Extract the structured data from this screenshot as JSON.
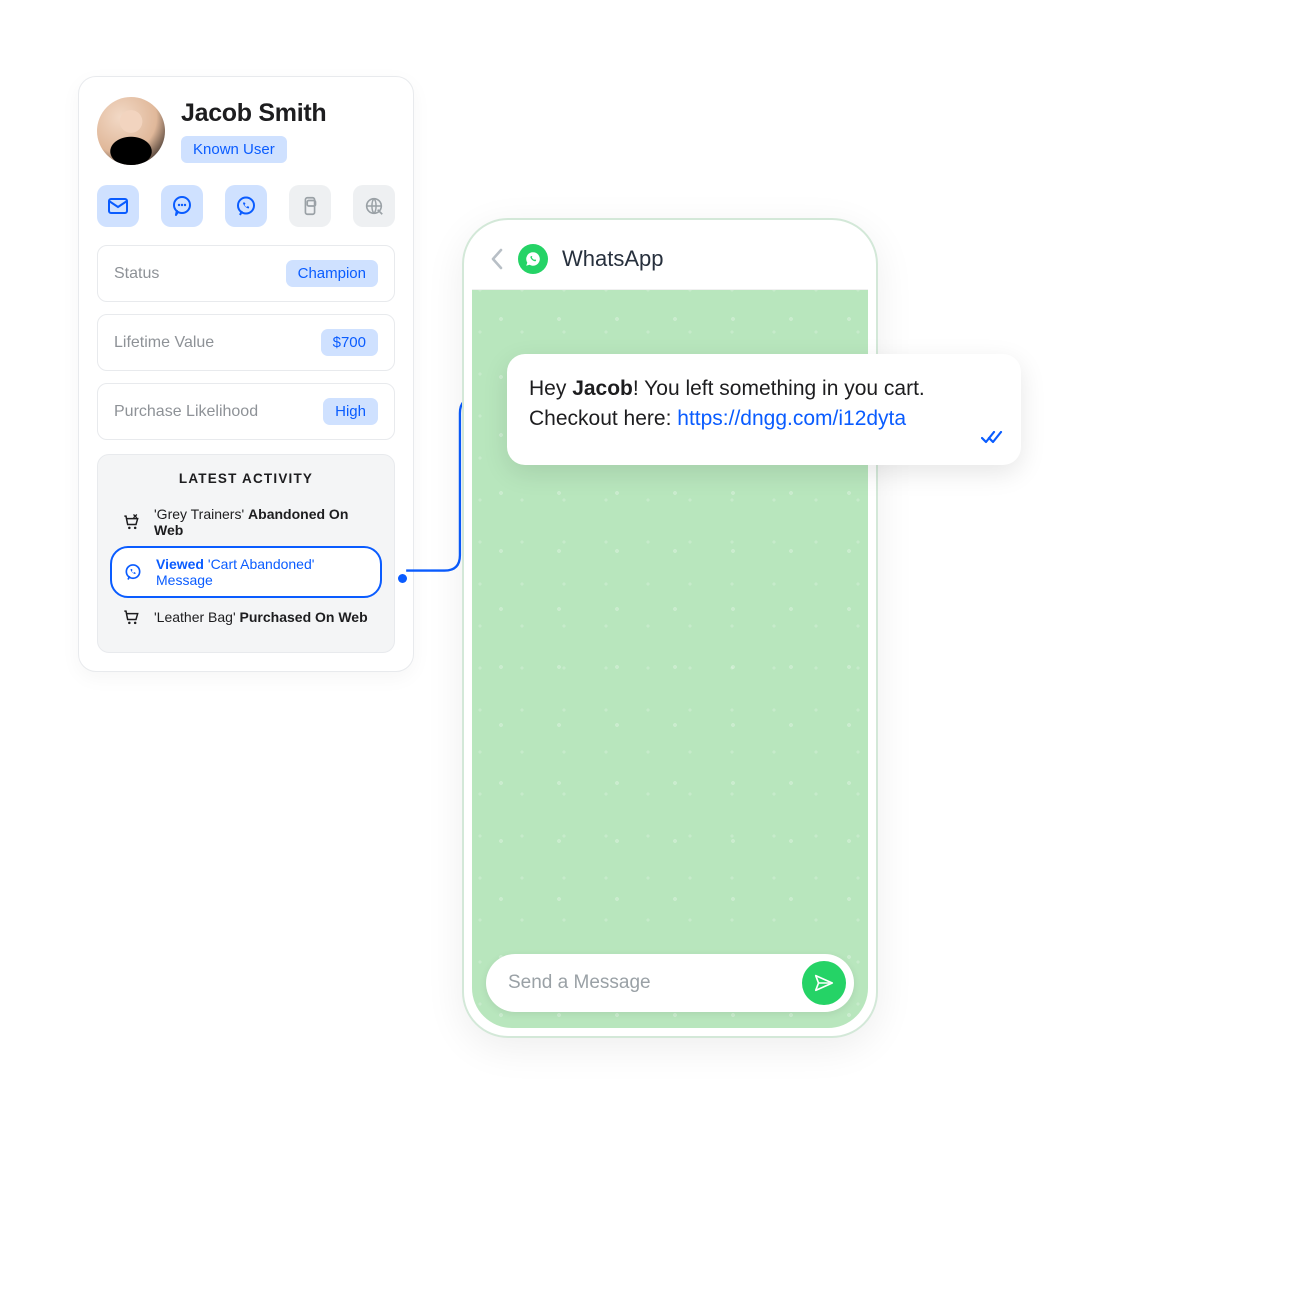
{
  "profile": {
    "name": "Jacob Smith",
    "badge": "Known User",
    "channels": [
      {
        "id": "email",
        "active": true
      },
      {
        "id": "sms",
        "active": true
      },
      {
        "id": "whatsapp",
        "active": true
      },
      {
        "id": "push",
        "active": false
      },
      {
        "id": "web",
        "active": false
      }
    ],
    "stats": [
      {
        "label": "Status",
        "value": "Champion"
      },
      {
        "label": "Lifetime Value",
        "value": "$700"
      },
      {
        "label": "Purchase Likelihood",
        "value": "High"
      }
    ],
    "activity_title": "LATEST ACTIVITY",
    "activities": [
      {
        "icon": "cart-x",
        "pre": "'Grey Trainers' ",
        "bold": "Abandoned On Web",
        "post": ""
      },
      {
        "icon": "whatsapp",
        "pre": "",
        "bold": "Viewed",
        "post": " 'Cart Abandoned' Message",
        "highlight": true
      },
      {
        "icon": "cart",
        "pre": "'Leather Bag' ",
        "bold": "Purchased On Web",
        "post": ""
      }
    ]
  },
  "phone": {
    "app_name": "WhatsApp",
    "compose_placeholder": "Send a Message"
  },
  "message": {
    "pre": "Hey ",
    "bold": "Jacob",
    "mid": "! You left something in you cart. Checkout here: ",
    "link": "https://dngg.com/i12dyta"
  },
  "colors": {
    "accent": "#0a5cff",
    "badge_bg": "#cfe1ff",
    "whatsapp_green": "#25d366",
    "chat_bg": "#b8e6bd"
  }
}
